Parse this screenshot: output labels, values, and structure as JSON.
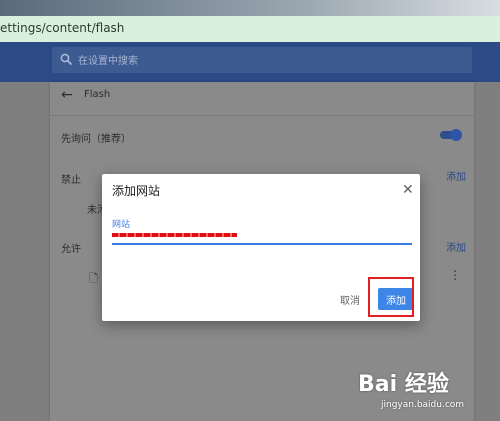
{
  "browser": {
    "url_text": "ettings/content/flash"
  },
  "header": {
    "search_placeholder": "在设置中搜索"
  },
  "page": {
    "title": "Flash",
    "ask_first_label": "先询问（推荐）",
    "ask_first_enabled": true,
    "block_section_label": "禁止",
    "block_add_label": "添加",
    "block_empty_text": "未添",
    "allow_section_label": "允许",
    "allow_add_label": "添加"
  },
  "dialog": {
    "title": "添加网站",
    "site_field_label": "网站",
    "site_field_value": "",
    "cancel_label": "取消",
    "add_label": "添加"
  },
  "watermark": {
    "logo_text": "Bai 经验",
    "url_text": "jingyan.baidu.com"
  },
  "colors": {
    "accent": "#3d86e8",
    "highlight": "#e02020",
    "header": "#2c4a86"
  }
}
